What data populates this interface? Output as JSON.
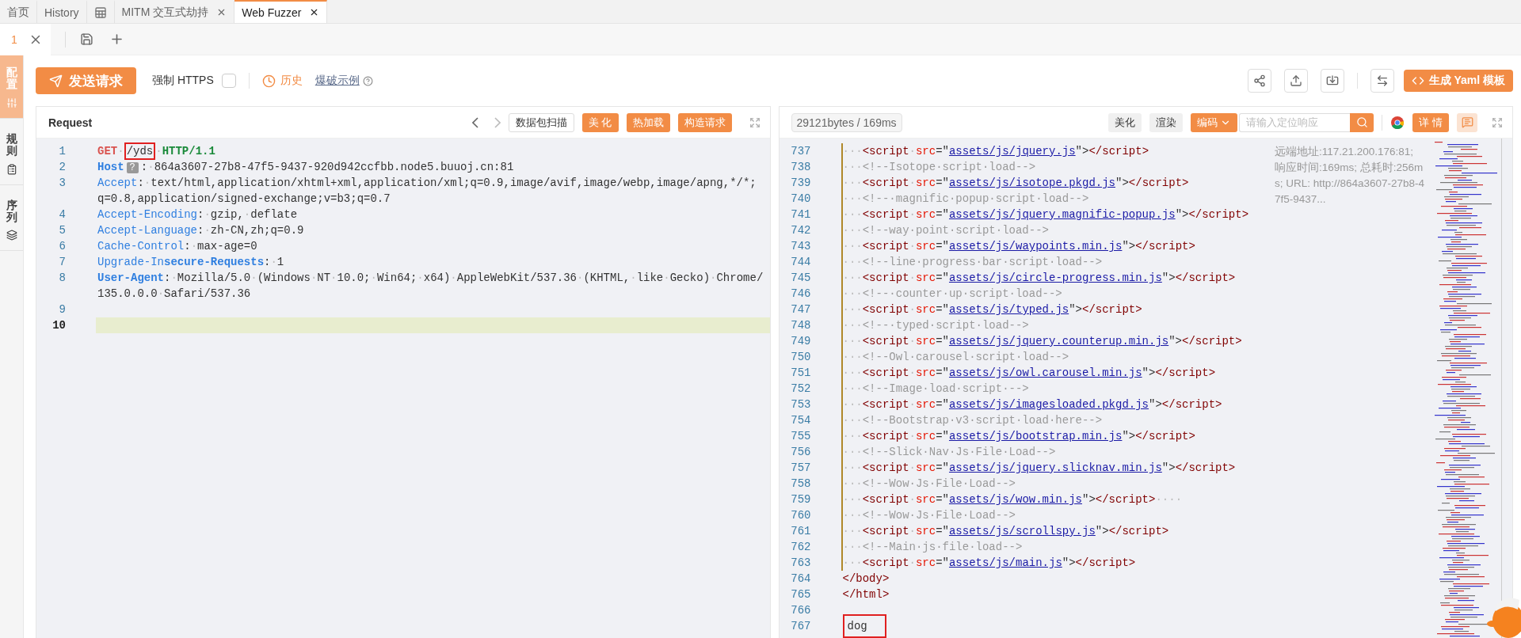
{
  "tabs": [
    {
      "kind": "text",
      "label": "首页",
      "selected": false,
      "closable": false
    },
    {
      "kind": "text",
      "label": "History",
      "selected": false,
      "closable": false
    },
    {
      "kind": "icon",
      "selected": false,
      "closable": false
    },
    {
      "kind": "text",
      "label": "MITM 交互式劫持",
      "selected": false,
      "closable": true
    },
    {
      "kind": "text",
      "label": "Web Fuzzer",
      "selected": true,
      "closable": true
    }
  ],
  "subtabs": [
    {
      "label": "1",
      "selected": true
    }
  ],
  "sidebar": [
    {
      "label": "配置",
      "kind": "sliders",
      "selected": true
    },
    {
      "label": "规则",
      "kind": "clipboard",
      "selected": false
    },
    {
      "label": "序列",
      "kind": "layers",
      "selected": false
    }
  ],
  "toolbar": {
    "send_button": "发送请求",
    "force_https": {
      "label": "强制 HTTPS",
      "checked": false
    },
    "history": "历史",
    "examples": "爆破示例",
    "yaml_button": "生成 Yaml 模板"
  },
  "request": {
    "title": "Request",
    "buttons": [
      {
        "label": "数据包扫描",
        "kind": "outline"
      },
      {
        "label": "美 化",
        "kind": "primary"
      },
      {
        "label": "热加载",
        "kind": "primary"
      },
      {
        "label": "构造请求",
        "kind": "primary"
      }
    ],
    "lines": [
      {
        "number": "1",
        "current": false,
        "tokens": [
          {
            "kind": "method",
            "text": "GET"
          },
          {
            "kind": "ws",
            "text": "·"
          },
          {
            "kind": "marked",
            "text": "/yds"
          },
          {
            "kind": "ws",
            "text": "·"
          },
          {
            "kind": "version",
            "text": "HTTP/1.1"
          }
        ]
      },
      {
        "number": "2",
        "current": false,
        "tokens": [
          {
            "kind": "keybold",
            "text": "Host"
          },
          {
            "kind": "hint",
            "text": "?"
          },
          {
            "kind": "plain",
            "text": ":"
          },
          {
            "kind": "ws",
            "text": "·"
          },
          {
            "kind": "plain",
            "text": "864a3607-27b8-47f5-9437-920d942ccfbb.node5.buuoj.cn:81"
          }
        ]
      },
      {
        "number": "3",
        "current": false,
        "tokens": [
          {
            "kind": "key",
            "text": "Accept"
          },
          {
            "kind": "plain",
            "text": ":"
          },
          {
            "kind": "ws",
            "text": "·"
          },
          {
            "kind": "plain",
            "text": "text/html,application/xhtml+xml,application/xml;q=0.9,image/avif,image/webp,image/apng,*/*;"
          }
        ],
        "wrap": [
          {
            "kind": "plain",
            "text": "q=0.8,application/signed-exchange;v=b3;q=0.7"
          }
        ]
      },
      {
        "number": "4",
        "current": false,
        "tokens": [
          {
            "kind": "key",
            "text": "Accept-Encoding"
          },
          {
            "kind": "plain",
            "text": ":"
          },
          {
            "kind": "ws",
            "text": "·"
          },
          {
            "kind": "plain",
            "text": "gzip,"
          },
          {
            "kind": "ws",
            "text": "·"
          },
          {
            "kind": "plain",
            "text": "deflate"
          }
        ]
      },
      {
        "number": "5",
        "current": false,
        "tokens": [
          {
            "kind": "key",
            "text": "Accept-Language"
          },
          {
            "kind": "plain",
            "text": ":"
          },
          {
            "kind": "ws",
            "text": "·"
          },
          {
            "kind": "plain",
            "text": "zh-CN,zh;q=0.9"
          }
        ]
      },
      {
        "number": "6",
        "current": false,
        "tokens": [
          {
            "kind": "key",
            "text": "Cache-Control"
          },
          {
            "kind": "plain",
            "text": ":"
          },
          {
            "kind": "ws",
            "text": "·"
          },
          {
            "kind": "plain",
            "text": "max-age=0"
          }
        ]
      },
      {
        "number": "7",
        "current": false,
        "tokens": [
          {
            "kind": "key",
            "text": "Upgrade-In"
          },
          {
            "kind": "keybold",
            "text": "secure-Requests"
          },
          {
            "kind": "plain",
            "text": ":"
          },
          {
            "kind": "ws",
            "text": "·"
          },
          {
            "kind": "plain",
            "text": "1"
          }
        ]
      },
      {
        "number": "8",
        "current": false,
        "tokens": [
          {
            "kind": "keybold",
            "text": "User-Agent"
          },
          {
            "kind": "plain",
            "text": ":"
          },
          {
            "kind": "ws",
            "text": "·"
          },
          {
            "kind": "plain",
            "text": "Mozilla/5.0"
          },
          {
            "kind": "ws",
            "text": "·"
          },
          {
            "kind": "plain",
            "text": "(Windows"
          },
          {
            "kind": "ws",
            "text": "·"
          },
          {
            "kind": "plain",
            "text": "NT"
          },
          {
            "kind": "ws",
            "text": "·"
          },
          {
            "kind": "plain",
            "text": "10.0;"
          },
          {
            "kind": "ws",
            "text": "·"
          },
          {
            "kind": "plain",
            "text": "Win64;"
          },
          {
            "kind": "ws",
            "text": "·"
          },
          {
            "kind": "plain",
            "text": "x64)"
          },
          {
            "kind": "ws",
            "text": "·"
          },
          {
            "kind": "plain",
            "text": "AppleWebKit/537.36"
          },
          {
            "kind": "ws",
            "text": "·"
          },
          {
            "kind": "plain",
            "text": "(KHTML,"
          },
          {
            "kind": "ws",
            "text": "·"
          },
          {
            "kind": "plain",
            "text": "like"
          },
          {
            "kind": "ws",
            "text": "·"
          },
          {
            "kind": "plain",
            "text": "Gecko)"
          },
          {
            "kind": "ws",
            "text": "·"
          },
          {
            "kind": "plain",
            "text": "Chrome/"
          }
        ],
        "wrap": [
          {
            "kind": "plain",
            "text": "135.0.0.0"
          },
          {
            "kind": "ws",
            "text": "·"
          },
          {
            "kind": "plain",
            "text": "Safari/537.36"
          }
        ]
      },
      {
        "number": "9",
        "current": false
      },
      {
        "number": "10",
        "current": true
      }
    ]
  },
  "response": {
    "size": "29121bytes / 169ms",
    "buttons": [
      {
        "label": "美化",
        "kind": "plain"
      },
      {
        "label": "渲染",
        "kind": "plain"
      },
      {
        "label": "编码",
        "kind": "dropdown"
      }
    ],
    "search": {
      "placeholder": "请输入定位响应"
    },
    "detail_button": "详 情",
    "info": "远端地址:117.21.200.176:81; 响应时间:169ms; 总耗时:256ms; URL: http://864a3607-27b8-47f5-9437...",
    "lines": [
      {
        "number": "737",
        "guide": true,
        "tokens": [
          {
            "kind": "ws",
            "text": "···"
          },
          {
            "kind": "tag",
            "text": "<script"
          },
          {
            "kind": "ws",
            "text": "·"
          },
          {
            "kind": "attr",
            "text": "src"
          },
          {
            "kind": "plain",
            "text": "=\""
          },
          {
            "kind": "link",
            "text": "assets/js/jquery.js"
          },
          {
            "kind": "plain",
            "text": "\">"
          },
          {
            "kind": "tag",
            "text": "</script>"
          }
        ]
      },
      {
        "number": "738",
        "guide": true,
        "tokens": [
          {
            "kind": "ws",
            "text": "···"
          },
          {
            "kind": "comment",
            "text": "<!--Isotope·script·load-->"
          }
        ]
      },
      {
        "number": "739",
        "guide": true,
        "tokens": [
          {
            "kind": "ws",
            "text": "···"
          },
          {
            "kind": "tag",
            "text": "<script"
          },
          {
            "kind": "ws",
            "text": "·"
          },
          {
            "kind": "attr",
            "text": "src"
          },
          {
            "kind": "plain",
            "text": "=\""
          },
          {
            "kind": "link",
            "text": "assets/js/isotope.pkgd.js"
          },
          {
            "kind": "plain",
            "text": "\">"
          },
          {
            "kind": "tag",
            "text": "</script>"
          }
        ]
      },
      {
        "number": "740",
        "guide": true,
        "tokens": [
          {
            "kind": "ws",
            "text": "···"
          },
          {
            "kind": "comment",
            "text": "<!--·magnific·popup·script·load-->"
          }
        ]
      },
      {
        "number": "741",
        "guide": true,
        "tokens": [
          {
            "kind": "ws",
            "text": "···"
          },
          {
            "kind": "tag",
            "text": "<script"
          },
          {
            "kind": "ws",
            "text": "·"
          },
          {
            "kind": "attr",
            "text": "src"
          },
          {
            "kind": "plain",
            "text": "=\""
          },
          {
            "kind": "link",
            "text": "assets/js/jquery.magnific-popup.js"
          },
          {
            "kind": "plain",
            "text": "\">"
          },
          {
            "kind": "tag",
            "text": "</script>"
          }
        ]
      },
      {
        "number": "742",
        "guide": true,
        "tokens": [
          {
            "kind": "ws",
            "text": "···"
          },
          {
            "kind": "comment",
            "text": "<!--way·point·script·load-->"
          }
        ]
      },
      {
        "number": "743",
        "guide": true,
        "tokens": [
          {
            "kind": "ws",
            "text": "···"
          },
          {
            "kind": "tag",
            "text": "<script"
          },
          {
            "kind": "ws",
            "text": "·"
          },
          {
            "kind": "attr",
            "text": "src"
          },
          {
            "kind": "plain",
            "text": "=\""
          },
          {
            "kind": "link",
            "text": "assets/js/waypoints.min.js"
          },
          {
            "kind": "plain",
            "text": "\">"
          },
          {
            "kind": "tag",
            "text": "</script>"
          }
        ]
      },
      {
        "number": "744",
        "guide": true,
        "tokens": [
          {
            "kind": "ws",
            "text": "···"
          },
          {
            "kind": "comment",
            "text": "<!--line·progress·bar·script·load-->"
          }
        ]
      },
      {
        "number": "745",
        "guide": true,
        "tokens": [
          {
            "kind": "ws",
            "text": "···"
          },
          {
            "kind": "tag",
            "text": "<script"
          },
          {
            "kind": "ws",
            "text": "·"
          },
          {
            "kind": "attr",
            "text": "src"
          },
          {
            "kind": "plain",
            "text": "=\""
          },
          {
            "kind": "link",
            "text": "assets/js/circle-progress.min.js"
          },
          {
            "kind": "plain",
            "text": "\">"
          },
          {
            "kind": "tag",
            "text": "</script>"
          }
        ]
      },
      {
        "number": "746",
        "guide": true,
        "tokens": [
          {
            "kind": "ws",
            "text": "···"
          },
          {
            "kind": "comment",
            "text": "<!--·counter·up·script·load-->"
          }
        ]
      },
      {
        "number": "747",
        "guide": true,
        "tokens": [
          {
            "kind": "ws",
            "text": "···"
          },
          {
            "kind": "tag",
            "text": "<script"
          },
          {
            "kind": "ws",
            "text": "·"
          },
          {
            "kind": "attr",
            "text": "src"
          },
          {
            "kind": "plain",
            "text": "=\""
          },
          {
            "kind": "link",
            "text": "assets/js/typed.js"
          },
          {
            "kind": "plain",
            "text": "\">"
          },
          {
            "kind": "tag",
            "text": "</script>"
          }
        ]
      },
      {
        "number": "748",
        "guide": true,
        "tokens": [
          {
            "kind": "ws",
            "text": "···"
          },
          {
            "kind": "comment",
            "text": "<!--·typed·script·load-->"
          }
        ]
      },
      {
        "number": "749",
        "guide": true,
        "tokens": [
          {
            "kind": "ws",
            "text": "···"
          },
          {
            "kind": "tag",
            "text": "<script"
          },
          {
            "kind": "ws",
            "text": "·"
          },
          {
            "kind": "attr",
            "text": "src"
          },
          {
            "kind": "plain",
            "text": "=\""
          },
          {
            "kind": "link",
            "text": "assets/js/jquery.counterup.min.js"
          },
          {
            "kind": "plain",
            "text": "\">"
          },
          {
            "kind": "tag",
            "text": "</script>"
          }
        ]
      },
      {
        "number": "750",
        "guide": true,
        "tokens": [
          {
            "kind": "ws",
            "text": "···"
          },
          {
            "kind": "comment",
            "text": "<!--Owl·carousel·script·load-->"
          }
        ]
      },
      {
        "number": "751",
        "guide": true,
        "tokens": [
          {
            "kind": "ws",
            "text": "···"
          },
          {
            "kind": "tag",
            "text": "<script"
          },
          {
            "kind": "ws",
            "text": "·"
          },
          {
            "kind": "attr",
            "text": "src"
          },
          {
            "kind": "plain",
            "text": "=\""
          },
          {
            "kind": "link",
            "text": "assets/js/owl.carousel.min.js"
          },
          {
            "kind": "plain",
            "text": "\">"
          },
          {
            "kind": "tag",
            "text": "</script>"
          }
        ]
      },
      {
        "number": "752",
        "guide": true,
        "tokens": [
          {
            "kind": "ws",
            "text": "···"
          },
          {
            "kind": "comment",
            "text": "<!--Image·load·script·-->"
          }
        ]
      },
      {
        "number": "753",
        "guide": true,
        "tokens": [
          {
            "kind": "ws",
            "text": "···"
          },
          {
            "kind": "tag",
            "text": "<script"
          },
          {
            "kind": "ws",
            "text": "·"
          },
          {
            "kind": "attr",
            "text": "src"
          },
          {
            "kind": "plain",
            "text": "=\""
          },
          {
            "kind": "link",
            "text": "assets/js/imagesloaded.pkgd.js"
          },
          {
            "kind": "plain",
            "text": "\">"
          },
          {
            "kind": "tag",
            "text": "</script>"
          }
        ]
      },
      {
        "number": "754",
        "guide": true,
        "tokens": [
          {
            "kind": "ws",
            "text": "···"
          },
          {
            "kind": "comment",
            "text": "<!--Bootstrap·v3·script·load·here-->"
          }
        ]
      },
      {
        "number": "755",
        "guide": true,
        "tokens": [
          {
            "kind": "ws",
            "text": "···"
          },
          {
            "kind": "tag",
            "text": "<script"
          },
          {
            "kind": "ws",
            "text": "·"
          },
          {
            "kind": "attr",
            "text": "src"
          },
          {
            "kind": "plain",
            "text": "=\""
          },
          {
            "kind": "link",
            "text": "assets/js/bootstrap.min.js"
          },
          {
            "kind": "plain",
            "text": "\">"
          },
          {
            "kind": "tag",
            "text": "</script>"
          }
        ]
      },
      {
        "number": "756",
        "guide": true,
        "tokens": [
          {
            "kind": "ws",
            "text": "···"
          },
          {
            "kind": "comment",
            "text": "<!--Slick·Nav·Js·File·Load-->"
          }
        ]
      },
      {
        "number": "757",
        "guide": true,
        "tokens": [
          {
            "kind": "ws",
            "text": "···"
          },
          {
            "kind": "tag",
            "text": "<script"
          },
          {
            "kind": "ws",
            "text": "·"
          },
          {
            "kind": "attr",
            "text": "src"
          },
          {
            "kind": "plain",
            "text": "=\""
          },
          {
            "kind": "link",
            "text": "assets/js/jquery.slicknav.min.js"
          },
          {
            "kind": "plain",
            "text": "\">"
          },
          {
            "kind": "tag",
            "text": "</script>"
          }
        ]
      },
      {
        "number": "758",
        "guide": true,
        "tokens": [
          {
            "kind": "ws",
            "text": "···"
          },
          {
            "kind": "comment",
            "text": "<!--Wow·Js·File·Load-->"
          }
        ]
      },
      {
        "number": "759",
        "guide": true,
        "tokens": [
          {
            "kind": "ws",
            "text": "···"
          },
          {
            "kind": "tag",
            "text": "<script"
          },
          {
            "kind": "ws",
            "text": "·"
          },
          {
            "kind": "attr",
            "text": "src"
          },
          {
            "kind": "plain",
            "text": "=\""
          },
          {
            "kind": "link",
            "text": "assets/js/wow.min.js"
          },
          {
            "kind": "plain",
            "text": "\">"
          },
          {
            "kind": "tag",
            "text": "</script>"
          },
          {
            "kind": "ws",
            "text": "····"
          }
        ]
      },
      {
        "number": "760",
        "guide": true,
        "tokens": [
          {
            "kind": "ws",
            "text": "···"
          },
          {
            "kind": "comment",
            "text": "<!--Wow·Js·File·Load-->"
          }
        ]
      },
      {
        "number": "761",
        "guide": true,
        "tokens": [
          {
            "kind": "ws",
            "text": "···"
          },
          {
            "kind": "tag",
            "text": "<script"
          },
          {
            "kind": "ws",
            "text": "·"
          },
          {
            "kind": "attr",
            "text": "src"
          },
          {
            "kind": "plain",
            "text": "=\""
          },
          {
            "kind": "link",
            "text": "assets/js/scrollspy.js"
          },
          {
            "kind": "plain",
            "text": "\">"
          },
          {
            "kind": "tag",
            "text": "</script>"
          }
        ]
      },
      {
        "number": "762",
        "guide": true,
        "tokens": [
          {
            "kind": "ws",
            "text": "···"
          },
          {
            "kind": "comment",
            "text": "<!--Main·js·file·load-->"
          }
        ]
      },
      {
        "number": "763",
        "guide": true,
        "tokens": [
          {
            "kind": "ws",
            "text": "···"
          },
          {
            "kind": "tag",
            "text": "<script"
          },
          {
            "kind": "ws",
            "text": "·"
          },
          {
            "kind": "attr",
            "text": "src"
          },
          {
            "kind": "plain",
            "text": "=\""
          },
          {
            "kind": "link",
            "text": "assets/js/main.js"
          },
          {
            "kind": "plain",
            "text": "\">"
          },
          {
            "kind": "tag",
            "text": "</script>"
          }
        ]
      },
      {
        "number": "764",
        "guide": false,
        "tokens": [
          {
            "kind": "tag",
            "text": "</body>"
          }
        ]
      },
      {
        "number": "765",
        "guide": false,
        "tokens": [
          {
            "kind": "tag",
            "text": "</html>"
          }
        ]
      },
      {
        "number": "766",
        "guide": false
      },
      {
        "number": "767",
        "guide": false,
        "tokens": [
          {
            "kind": "marked",
            "text": "dog"
          }
        ]
      }
    ]
  }
}
